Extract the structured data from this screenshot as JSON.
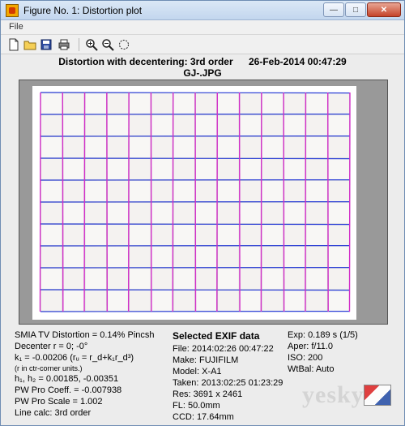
{
  "window": {
    "title": "Figure No. 1: Distortion plot",
    "buttons": {
      "minimize": "—",
      "maximize": "□",
      "close": "✕"
    }
  },
  "menubar": {
    "items": [
      "File"
    ]
  },
  "toolbar": {
    "icons": [
      "new-file-icon",
      "open-folder-icon",
      "save-icon",
      "print-icon",
      "zoom-in-icon",
      "zoom-out-icon",
      "rotate-icon"
    ]
  },
  "plot": {
    "title_left": "Distortion with decentering:  3rd order",
    "title_right": "26-Feb-2014 00:47:29",
    "subtitle": "GJ-.JPG",
    "background_color": "#999999",
    "grid_color_horizontal": "#2b3fd6",
    "grid_color_vertical": "#d12ec8",
    "grid_rows": 10,
    "grid_cols": 14
  },
  "left_stats": {
    "smia": "SMIA TV Distortion = 0.14% Pincsh",
    "decenter": "Decenter r = 0;  -0°",
    "k1": "k₁ = -0.00206  (rᵤ = r_d+k₁r_d³)",
    "rinctr": "(r in ctr-corner units.)",
    "h": "h₁, h₂ = 0.00185, -0.00351",
    "pw_coeff": "PW Pro Coeff. = -0.007938",
    "pw_scale": "PW Pro Scale = 1.002",
    "line_calc": "Line calc: 3rd order"
  },
  "exif": {
    "heading": "Selected EXIF data",
    "file": "File:  2014:02:26 00:47:22",
    "make": "Make:  FUJIFILM",
    "model": "Model:  X-A1",
    "taken": "Taken: 2013:02:25 01:23:29",
    "res": "Res:   3691 x 2461",
    "fl": "FL:   50.0mm",
    "ccd": "CCD:   17.64mm"
  },
  "right_stats": {
    "exp": "Exp:   0.189 s  (1/5)",
    "aper": "Aper:  f/11.0",
    "iso": "ISO:   200",
    "wtbal": "WtBal:  Auto"
  },
  "watermark": {
    "text": "yesky"
  }
}
